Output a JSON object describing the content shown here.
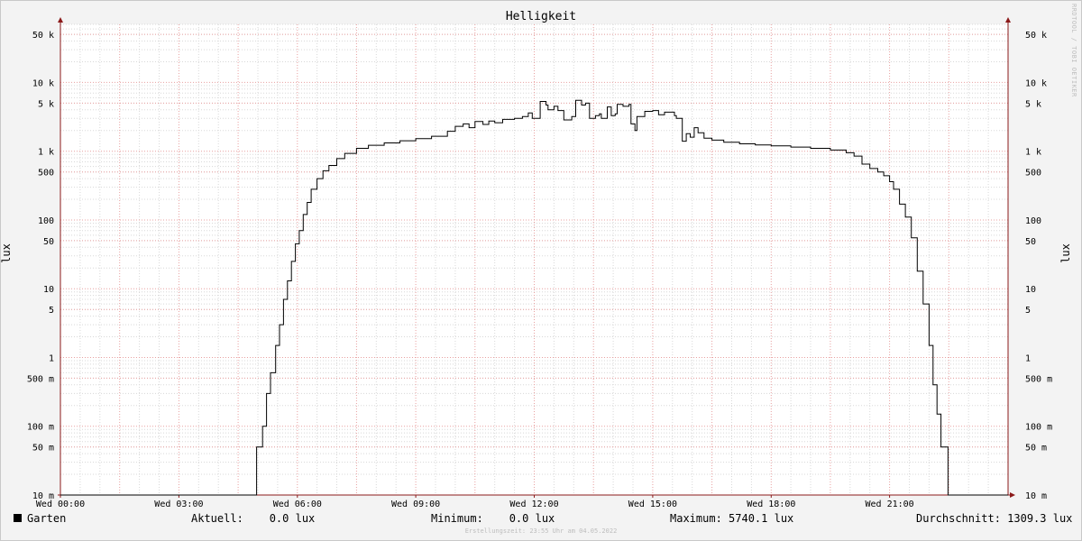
{
  "chart_data": {
    "type": "line",
    "title": "Helligkeit",
    "ylabel": "lux",
    "y_scale": "log",
    "ylim": [
      0.01,
      70000
    ],
    "y_ticks": [
      {
        "value": 0.01,
        "label": "10 m"
      },
      {
        "value": 0.05,
        "label": "50 m"
      },
      {
        "value": 0.1,
        "label": "100 m"
      },
      {
        "value": 0.5,
        "label": "500 m"
      },
      {
        "value": 1,
        "label": "1"
      },
      {
        "value": 5,
        "label": "5"
      },
      {
        "value": 10,
        "label": "10"
      },
      {
        "value": 50,
        "label": "50"
      },
      {
        "value": 100,
        "label": "100"
      },
      {
        "value": 500,
        "label": "500"
      },
      {
        "value": 1000,
        "label": "1 k"
      },
      {
        "value": 5000,
        "label": "5 k"
      },
      {
        "value": 10000,
        "label": "10 k"
      },
      {
        "value": 50000,
        "label": "50 k"
      }
    ],
    "x_unit": "hours",
    "xlim": [
      0,
      24
    ],
    "x_ticks": [
      {
        "value": 0,
        "label": "Wed 00:00"
      },
      {
        "value": 3,
        "label": "Wed 03:00"
      },
      {
        "value": 6,
        "label": "Wed 06:00"
      },
      {
        "value": 9,
        "label": "Wed 09:00"
      },
      {
        "value": 12,
        "label": "Wed 12:00"
      },
      {
        "value": 15,
        "label": "Wed 15:00"
      },
      {
        "value": 18,
        "label": "Wed 18:00"
      },
      {
        "value": 21,
        "label": "Wed 21:00"
      }
    ],
    "grid": true,
    "series": [
      {
        "name": "Garten",
        "color": "#000000",
        "points": [
          [
            0.0,
            0.01
          ],
          [
            4.95,
            0.01
          ],
          [
            4.97,
            0.05
          ],
          [
            5.12,
            0.1
          ],
          [
            5.22,
            0.3
          ],
          [
            5.32,
            0.6
          ],
          [
            5.45,
            1.5
          ],
          [
            5.55,
            3
          ],
          [
            5.65,
            7
          ],
          [
            5.75,
            13
          ],
          [
            5.85,
            25
          ],
          [
            5.95,
            45
          ],
          [
            6.05,
            70
          ],
          [
            6.15,
            120
          ],
          [
            6.25,
            180
          ],
          [
            6.35,
            280
          ],
          [
            6.5,
            400
          ],
          [
            6.65,
            520
          ],
          [
            6.8,
            620
          ],
          [
            7.0,
            780
          ],
          [
            7.2,
            930
          ],
          [
            7.5,
            1100
          ],
          [
            7.8,
            1220
          ],
          [
            8.2,
            1320
          ],
          [
            8.6,
            1420
          ],
          [
            9.0,
            1520
          ],
          [
            9.4,
            1650
          ],
          [
            9.8,
            1950
          ],
          [
            10.0,
            2300
          ],
          [
            10.2,
            2500
          ],
          [
            10.35,
            2200
          ],
          [
            10.5,
            2700
          ],
          [
            10.7,
            2450
          ],
          [
            10.85,
            2750
          ],
          [
            11.0,
            2600
          ],
          [
            11.2,
            2900
          ],
          [
            11.5,
            3000
          ],
          [
            11.7,
            3200
          ],
          [
            11.85,
            3600
          ],
          [
            11.95,
            3000
          ],
          [
            12.1,
            3000
          ],
          [
            12.15,
            5300
          ],
          [
            12.3,
            4700
          ],
          [
            12.35,
            4000
          ],
          [
            12.5,
            4500
          ],
          [
            12.6,
            3900
          ],
          [
            12.75,
            2850
          ],
          [
            12.95,
            3200
          ],
          [
            13.05,
            5500
          ],
          [
            13.2,
            4700
          ],
          [
            13.3,
            5000
          ],
          [
            13.4,
            3000
          ],
          [
            13.55,
            3300
          ],
          [
            13.65,
            3500
          ],
          [
            13.7,
            3000
          ],
          [
            13.85,
            4400
          ],
          [
            13.95,
            3300
          ],
          [
            14.05,
            3500
          ],
          [
            14.1,
            4800
          ],
          [
            14.25,
            4500
          ],
          [
            14.4,
            4800
          ],
          [
            14.45,
            2500
          ],
          [
            14.55,
            2000
          ],
          [
            14.6,
            3200
          ],
          [
            14.8,
            3800
          ],
          [
            15.0,
            3900
          ],
          [
            15.15,
            3400
          ],
          [
            15.3,
            3700
          ],
          [
            15.45,
            3700
          ],
          [
            15.55,
            3300
          ],
          [
            15.6,
            3000
          ],
          [
            15.75,
            1400
          ],
          [
            15.85,
            1800
          ],
          [
            15.95,
            1600
          ],
          [
            16.05,
            2200
          ],
          [
            16.15,
            1850
          ],
          [
            16.3,
            1550
          ],
          [
            16.5,
            1450
          ],
          [
            16.8,
            1350
          ],
          [
            17.2,
            1280
          ],
          [
            17.6,
            1230
          ],
          [
            18.0,
            1200
          ],
          [
            18.5,
            1150
          ],
          [
            19.0,
            1100
          ],
          [
            19.5,
            1040
          ],
          [
            19.9,
            950
          ],
          [
            20.1,
            850
          ],
          [
            20.3,
            650
          ],
          [
            20.5,
            560
          ],
          [
            20.7,
            500
          ],
          [
            20.85,
            440
          ],
          [
            21.0,
            360
          ],
          [
            21.1,
            280
          ],
          [
            21.25,
            170
          ],
          [
            21.4,
            110
          ],
          [
            21.55,
            55
          ],
          [
            21.7,
            18
          ],
          [
            21.85,
            6
          ],
          [
            22.0,
            1.5
          ],
          [
            22.1,
            0.4
          ],
          [
            22.2,
            0.15
          ],
          [
            22.3,
            0.05
          ],
          [
            22.45,
            0.05
          ],
          [
            22.48,
            0.01
          ],
          [
            24.0,
            0.01
          ]
        ]
      }
    ]
  },
  "legend": {
    "label": "Garten",
    "current": "Aktuell:    0.0 lux",
    "minimum": "Minimum:    0.0 lux",
    "maximum": "Maximum: 5740.1 lux",
    "average": "Durchschnitt: 1309.3 lux"
  },
  "footer": "Erstellungszeit: 23:55 Uhr am 04.05.2022",
  "vendor": "RRDTOOL / TOBI OETIKER",
  "colors": {
    "background": "#f3f3f3",
    "plot": "#ffffff",
    "minor_grid": "#d8d8d8",
    "major_grid": "#e8a0a0",
    "axis": "#8b1a1a",
    "line": "#000000"
  }
}
